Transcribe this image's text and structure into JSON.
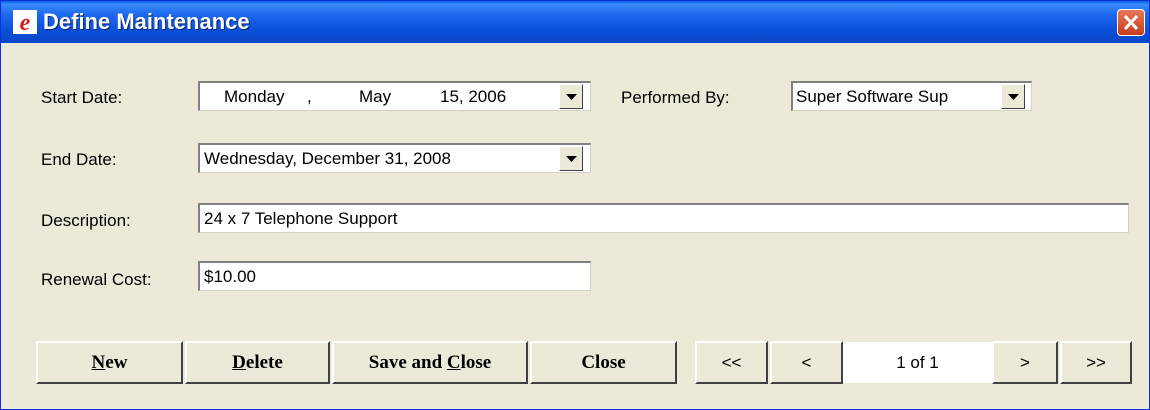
{
  "window": {
    "title": "Define Maintenance",
    "app_icon": "e-logo-icon",
    "close_icon": "close-icon",
    "accent_color": "#0A4FD8"
  },
  "form": {
    "start_date": {
      "label": "Start Date:",
      "weekday": "Monday",
      "comma": ",",
      "month": "May",
      "day_year": "15, 2006"
    },
    "performed_by": {
      "label": "Performed By:",
      "value": "Super Software Sup"
    },
    "end_date": {
      "label": "End Date:",
      "value": "Wednesday, December 31, 2008"
    },
    "description": {
      "label": "Description:",
      "value": "24 x 7 Telephone Support"
    },
    "renewal_cost": {
      "label": "Renewal Cost:",
      "value": "$10.00"
    }
  },
  "buttons": {
    "new_key": "N",
    "new_rest": "ew",
    "delete_key": "D",
    "delete_rest": "elete",
    "save_close_pre": "Save and ",
    "save_close_key": "C",
    "save_close_rest": "lose",
    "close": "Close"
  },
  "navigation": {
    "first": "<<",
    "prev": "<",
    "record_counter": "1 of 1",
    "next": ">",
    "last": ">>"
  }
}
